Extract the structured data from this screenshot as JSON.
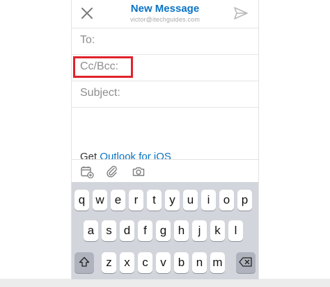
{
  "header": {
    "title": "New Message",
    "account": "victor@itechguides.com"
  },
  "fields": {
    "to_label": "To:",
    "cc_label": "Cc/Bcc:",
    "subject_label": "Subject:"
  },
  "body": {
    "signature_prefix": "Get ",
    "signature_link": "Outlook for iOS"
  },
  "icons": {
    "close": "close-icon",
    "send": "send-icon",
    "calendar": "calendar-add-icon",
    "attach": "paperclip-icon",
    "camera": "camera-icon",
    "shift": "shift-icon",
    "backspace": "backspace-icon"
  },
  "colors": {
    "accent": "#0a73c4",
    "highlight": "#e0232b",
    "keyboard_bg": "#d2d5db"
  },
  "keyboard": {
    "row1": [
      "q",
      "w",
      "e",
      "r",
      "t",
      "y",
      "u",
      "i",
      "o",
      "p"
    ],
    "row2": [
      "a",
      "s",
      "d",
      "f",
      "g",
      "h",
      "j",
      "k",
      "l"
    ],
    "row3": [
      "z",
      "x",
      "c",
      "v",
      "b",
      "n",
      "m"
    ]
  }
}
